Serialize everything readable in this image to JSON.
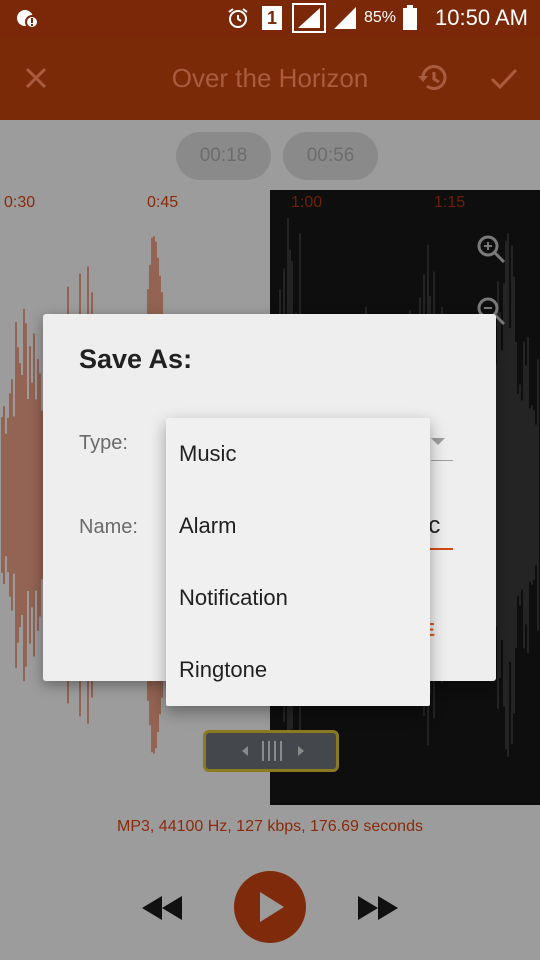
{
  "status_bar": {
    "time": "10:50 AM",
    "battery_percent": "85%",
    "sim_number": "1"
  },
  "toolbar": {
    "title": "Over the Horizon"
  },
  "pills": {
    "start": "00:18",
    "end": "00:56"
  },
  "timeline": {
    "ticks": [
      "0:30",
      "0:45",
      "1:00",
      "1:15"
    ]
  },
  "info_text": "MP3, 44100 Hz, 127 kbps, 176.69 seconds",
  "dialog": {
    "title": "Save As:",
    "type_label": "Type:",
    "name_label": "Name:",
    "name_value_fragment": "ic",
    "save_fragment": "E"
  },
  "dropdown": {
    "options": [
      "Music",
      "Alarm",
      "Notification",
      "Ringtone"
    ]
  },
  "colors": {
    "accent": "#e05a1a",
    "toolbar": "#7b2a07",
    "waveform": "#8a2a0a"
  }
}
